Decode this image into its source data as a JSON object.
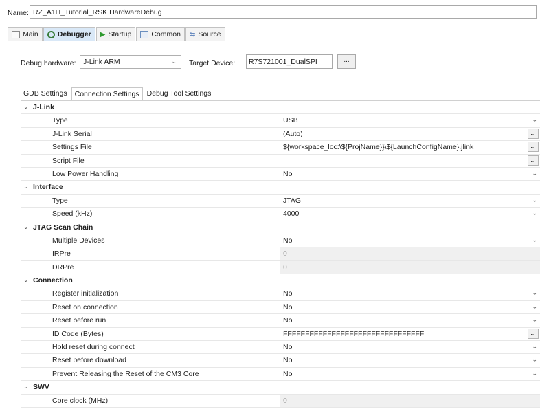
{
  "name": {
    "label": "Name:",
    "value": "RZ_A1H_Tutorial_RSK HardwareDebug"
  },
  "tabs": [
    {
      "label": "Main",
      "icon": "main-tab-icon",
      "active": false
    },
    {
      "label": "Debugger",
      "icon": "debugger-tab-icon",
      "active": true
    },
    {
      "label": "Startup",
      "icon": "startup-tab-icon",
      "active": false
    },
    {
      "label": "Common",
      "icon": "common-tab-icon",
      "active": false
    },
    {
      "label": "Source",
      "icon": "source-tab-icon",
      "active": false
    }
  ],
  "debug_hw": {
    "label": "Debug hardware:",
    "value": "J-Link ARM"
  },
  "target_device": {
    "label": "Target Device:",
    "value": "R7S721001_DualSPI",
    "browse": "..."
  },
  "subtabs": [
    {
      "label": "GDB Settings",
      "active": false
    },
    {
      "label": "Connection Settings",
      "active": true
    },
    {
      "label": "Debug Tool Settings",
      "active": false
    }
  ],
  "rows": [
    {
      "kind": "cat",
      "label": "J-Link"
    },
    {
      "kind": "prop",
      "label": "Type",
      "value": "USB",
      "control": "dropdown"
    },
    {
      "kind": "prop",
      "label": "J-Link Serial",
      "value": "(Auto)",
      "control": "browse"
    },
    {
      "kind": "prop",
      "label": "Settings File",
      "value": "${workspace_loc:\\${ProjName}}\\${LaunchConfigName}.jlink",
      "control": "browse"
    },
    {
      "kind": "prop",
      "label": "Script File",
      "value": "",
      "control": "browse"
    },
    {
      "kind": "prop",
      "label": "Low Power Handling",
      "value": "No",
      "control": "dropdown"
    },
    {
      "kind": "cat",
      "label": "Interface"
    },
    {
      "kind": "prop",
      "label": "Type",
      "value": "JTAG",
      "control": "dropdown"
    },
    {
      "kind": "prop",
      "label": "Speed (kHz)",
      "value": "4000",
      "control": "dropdown"
    },
    {
      "kind": "cat",
      "label": "JTAG Scan Chain"
    },
    {
      "kind": "prop",
      "label": "Multiple Devices",
      "value": "No",
      "control": "dropdown"
    },
    {
      "kind": "prop",
      "label": "IRPre",
      "value": "0",
      "control": "none",
      "disabled": true
    },
    {
      "kind": "prop",
      "label": "DRPre",
      "value": "0",
      "control": "none",
      "disabled": true
    },
    {
      "kind": "cat",
      "label": "Connection"
    },
    {
      "kind": "prop",
      "label": "Register initialization",
      "value": "No",
      "control": "dropdown"
    },
    {
      "kind": "prop",
      "label": "Reset on connection",
      "value": "No",
      "control": "dropdown"
    },
    {
      "kind": "prop",
      "label": "Reset before run",
      "value": "No",
      "control": "dropdown"
    },
    {
      "kind": "prop",
      "label": "ID Code (Bytes)",
      "value": "FFFFFFFFFFFFFFFFFFFFFFFFFFFFFFFF",
      "control": "browse"
    },
    {
      "kind": "prop",
      "label": "Hold reset during connect",
      "value": "No",
      "control": "dropdown"
    },
    {
      "kind": "prop",
      "label": "Reset before download",
      "value": "No",
      "control": "dropdown"
    },
    {
      "kind": "prop",
      "label": "Prevent Releasing the Reset of the CM3 Core",
      "value": "No",
      "control": "dropdown"
    },
    {
      "kind": "cat",
      "label": "SWV"
    },
    {
      "kind": "prop",
      "label": "Core clock (MHz)",
      "value": "0",
      "control": "none",
      "disabled": true
    }
  ]
}
